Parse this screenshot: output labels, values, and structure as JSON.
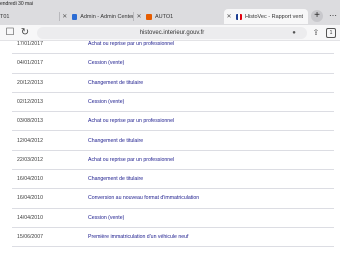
{
  "status": {
    "date_text": "endredi 30 mai"
  },
  "tabs": [
    {
      "label": "T01"
    },
    {
      "label": "Admin - Admin Center"
    },
    {
      "label": "AUTO1"
    },
    {
      "label": "HistoVec - Rapport vent"
    }
  ],
  "toolbar": {
    "url": "histovec.interieur.gouv.fr",
    "tab_count": "1"
  },
  "rows": [
    {
      "date": "17/01/2017",
      "operation": "Achat ou reprise par un professionnel"
    },
    {
      "date": "04/01/2017",
      "operation": "Cession (vente)"
    },
    {
      "date": "20/12/2013",
      "operation": "Changement de titulaire"
    },
    {
      "date": "02/12/2013",
      "operation": "Cession (vente)"
    },
    {
      "date": "03/08/2013",
      "operation": "Achat ou reprise par un professionnel"
    },
    {
      "date": "12/04/2012",
      "operation": "Changement de titulaire"
    },
    {
      "date": "22/03/2012",
      "operation": "Achat ou reprise par un professionnel"
    },
    {
      "date": "16/04/2010",
      "operation": "Changement de titulaire"
    },
    {
      "date": "16/04/2010",
      "operation": "Conversion au nouveau format d'immatriculation"
    },
    {
      "date": "14/04/2010",
      "operation": "Cession (vente)"
    },
    {
      "date": "15/06/2007",
      "operation": "Première immatriculation d'un véhicule neuf"
    }
  ],
  "colors": {
    "link": "#1a1a8c",
    "tab_bar": "#dcdcdf"
  }
}
